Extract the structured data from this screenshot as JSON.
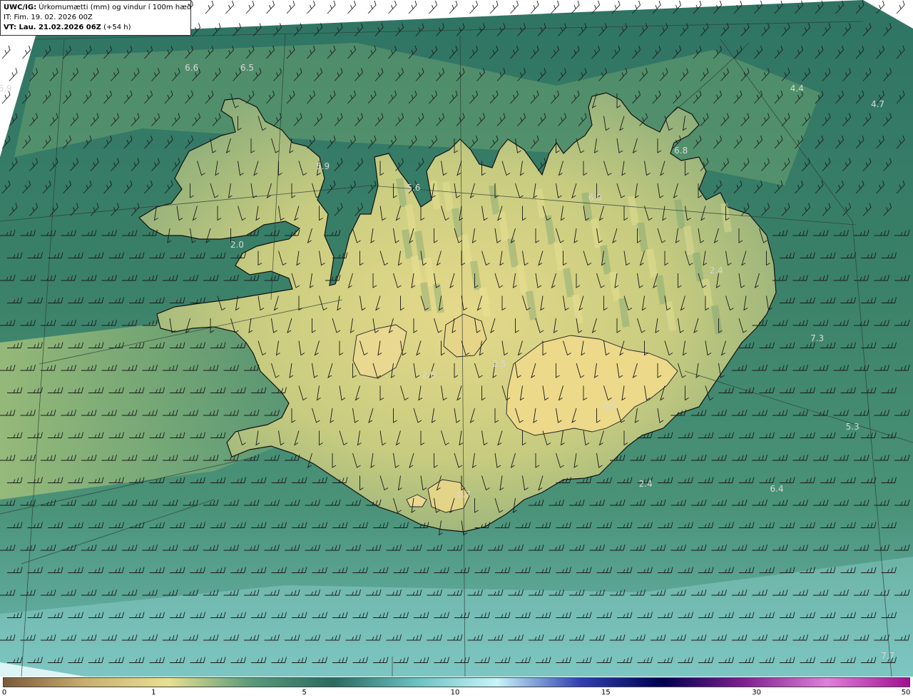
{
  "info": {
    "prefix": "UWC/IG:",
    "title": "Úrkomumætti (mm) og vindur í 100m hæð",
    "it_line": "IT: Fim. 19. 02. 2026 00Z",
    "vt_prefix": "VT: Lau. 21.02.2026 06Z",
    "vt_suffix": "(+54 h)"
  },
  "value_labels": [
    {
      "text": "6.9",
      "lon": -28.7,
      "lat": 67.55
    },
    {
      "text": "6.6",
      "lon": -25.0,
      "lat": 67.75
    },
    {
      "text": "6.5",
      "lon": -23.9,
      "lat": 67.75
    },
    {
      "text": "5.9",
      "lon": -22.4,
      "lat": 66.8
    },
    {
      "text": "5.6",
      "lon": -20.6,
      "lat": 66.6
    },
    {
      "text": "6.0",
      "lon": -17.0,
      "lat": 66.5
    },
    {
      "text": "6.8",
      "lon": -15.3,
      "lat": 66.95
    },
    {
      "text": "4.4",
      "lon": -13.0,
      "lat": 67.55
    },
    {
      "text": "4.7",
      "lon": -11.4,
      "lat": 67.4
    },
    {
      "text": "2.4",
      "lon": -14.6,
      "lat": 65.8
    },
    {
      "text": "7.3",
      "lon": -12.6,
      "lat": 65.15
    },
    {
      "text": "5.3",
      "lon": -11.9,
      "lat": 64.3
    },
    {
      "text": "6.4",
      "lon": -13.4,
      "lat": 63.7
    },
    {
      "text": "2.0",
      "lon": -24.1,
      "lat": 66.05
    },
    {
      "text": "0.5",
      "lon": -16.7,
      "lat": 64.5
    },
    {
      "text": "2.0",
      "lon": -20.3,
      "lat": 64.8
    },
    {
      "text": "2.5",
      "lon": -18.9,
      "lat": 64.9
    },
    {
      "text": "2.4",
      "lon": -16.0,
      "lat": 63.75
    },
    {
      "text": "0.7",
      "lon": -19.6,
      "lat": 63.65
    },
    {
      "text": "7.7",
      "lon": -11.2,
      "lat": 62.1
    }
  ],
  "colorbar": {
    "ticks": [
      "0",
      "1",
      "5",
      "10",
      "15",
      "30",
      "50"
    ],
    "stops": [
      "#7a5a3a",
      "#c8b070",
      "#e8e090",
      "#5a9a7a",
      "#2a6a60",
      "#6ac0c0",
      "#c8f4f8",
      "#3040b0",
      "#000050",
      "#802090",
      "#e080d8",
      "#a01090"
    ]
  },
  "map": {
    "lon_min": -28.8,
    "lon_max": -10.7,
    "lat_min": 61.9,
    "lat_max": 68.4,
    "sea_color": "#3f7f6c",
    "land_color": "#c4c67c",
    "coast_color": "#111111"
  }
}
